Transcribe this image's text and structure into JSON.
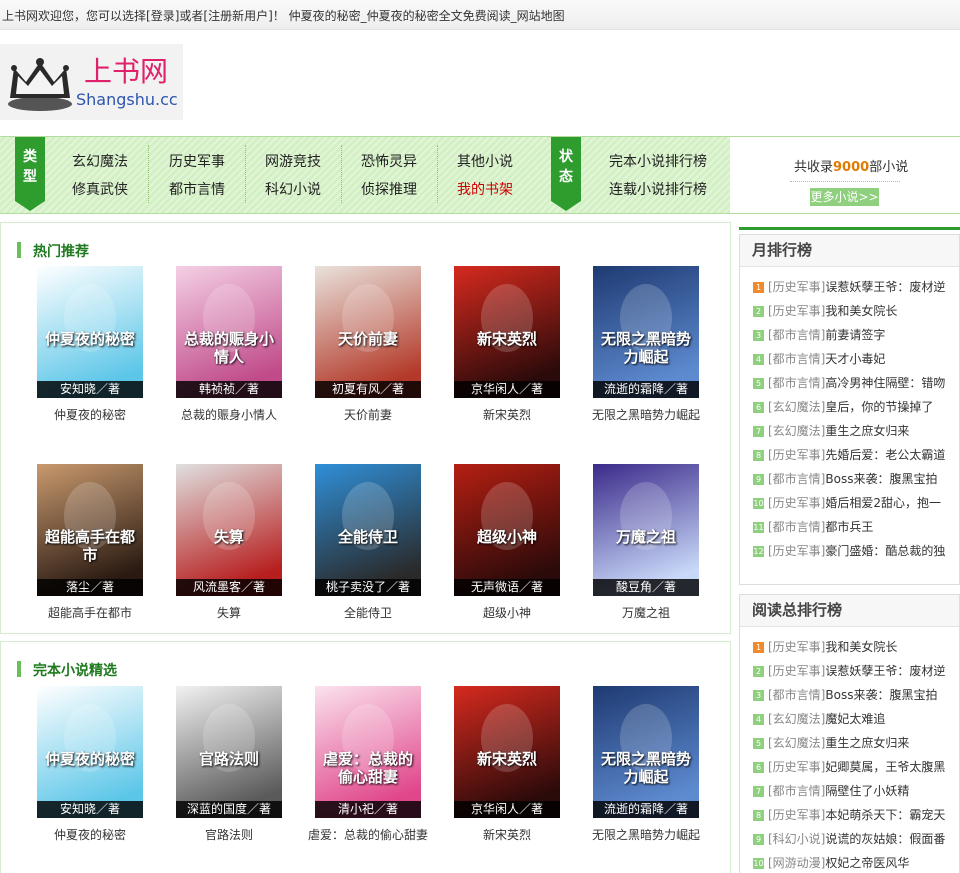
{
  "header": {
    "welcome_prefix": "上书网欢迎您，您可以选择[",
    "login": "登录",
    "or": "]或者[",
    "register": "注册新用户",
    "welcome_suffix": "]！ 仲夏夜的秘密_仲夏夜的秘密全文免费阅读_网站地图"
  },
  "logo": {
    "cn": "上书网",
    "en": "Shangshu.cc"
  },
  "nav": {
    "type_label": [
      "类",
      "型"
    ],
    "status_label": [
      "状",
      "态"
    ],
    "links": [
      "玄幻魔法",
      "修真武侠",
      "历史军事",
      "都市言情",
      "网游竞技",
      "科幻小说",
      "恐怖灵异",
      "侦探推理",
      "其他小说",
      "我的书架"
    ],
    "status_links": [
      "完本小说排行榜",
      "连载小说排行榜"
    ],
    "count_prefix": "共收录",
    "count_num": "9000",
    "count_suffix": "部小说",
    "more": "更多小说>>"
  },
  "hot": {
    "title": "热门推荐",
    "books": [
      {
        "title": "仲夏夜的秘密",
        "author": "安知晓／著",
        "colors": [
          "#ffffff",
          "#5cc6e8"
        ],
        "cover_text": "仲夏夜的秘密"
      },
      {
        "title": "总裁的赈身小情人",
        "author": "韩祯祯／著",
        "colors": [
          "#f4d0e4",
          "#c04a8a"
        ],
        "cover_text": "总裁的赈身小情人"
      },
      {
        "title": "天价前妻",
        "author": "初夏有风／著",
        "colors": [
          "#e9e2dc",
          "#b33a2a"
        ],
        "cover_text": "天价前妻"
      },
      {
        "title": "新宋英烈",
        "author": "京华闲人／著",
        "colors": [
          "#d62a1e",
          "#2a0a0a"
        ],
        "cover_text": "新宋英烈"
      },
      {
        "title": "无限之黑暗势力崛起",
        "author": "流逝的霜降／著",
        "colors": [
          "#1e3a72",
          "#5e8bd0"
        ],
        "cover_text": "无限之黑暗势力崛起"
      },
      {
        "title": "超能高手在都市",
        "author": "落尘／著",
        "colors": [
          "#c99a6e",
          "#2a1a12"
        ],
        "cover_text": "超能高手在都市"
      },
      {
        "title": "失算",
        "author": "风流墨客／著",
        "colors": [
          "#e0e0e0",
          "#b71e1e"
        ],
        "cover_text": "失算"
      },
      {
        "title": "全能侍卫",
        "author": "桃子卖没了／著",
        "colors": [
          "#2f8fd8",
          "#2a2a2a"
        ],
        "cover_text": "全能侍卫"
      },
      {
        "title": "超级小神",
        "author": "无声微语／著",
        "colors": [
          "#b51f12",
          "#2a0a0a"
        ],
        "cover_text": "超级小神"
      },
      {
        "title": "万魔之祖",
        "author": "酸豆角／著",
        "colors": [
          "#3a2a8a",
          "#c8d8f8"
        ],
        "cover_text": "万魔之祖"
      }
    ]
  },
  "finished": {
    "title": "完本小说精选",
    "books": [
      {
        "title": "仲夏夜的秘密",
        "author": "安知晓／著",
        "colors": [
          "#ffffff",
          "#5cc6e8"
        ],
        "cover_text": "仲夏夜的秘密"
      },
      {
        "title": "官路法则",
        "author": "深蓝的国度／著",
        "colors": [
          "#f2f2f2",
          "#5a5a5a"
        ],
        "cover_text": "官路法则"
      },
      {
        "title": "虐爱：总裁的偷心甜妻",
        "author": "清小祀／著",
        "colors": [
          "#fbe2ee",
          "#e0468a"
        ],
        "cover_text": "虐爱：总裁的偷心甜妻"
      },
      {
        "title": "新宋英烈",
        "author": "京华闲人／著",
        "colors": [
          "#d62a1e",
          "#2a0a0a"
        ],
        "cover_text": "新宋英烈"
      },
      {
        "title": "无限之黑暗势力崛起",
        "author": "流逝的霜降／著",
        "colors": [
          "#1e3a72",
          "#5e8bd0"
        ],
        "cover_text": "无限之黑暗势力崛起"
      }
    ]
  },
  "monthly": {
    "title": "月排行榜",
    "items": [
      {
        "num": "1",
        "cat": "[历史军事]",
        "name": "误惹妖孽王爷：废材逆"
      },
      {
        "num": "2",
        "cat": "[历史军事]",
        "name": "我和美女院长"
      },
      {
        "num": "3",
        "cat": "[都市言情]",
        "name": "前妻请签字"
      },
      {
        "num": "4",
        "cat": "[都市言情]",
        "name": "天才小毒妃"
      },
      {
        "num": "5",
        "cat": "[都市言情]",
        "name": "高冷男神住隔壁：错吻"
      },
      {
        "num": "6",
        "cat": "[玄幻魔法]",
        "name": "皇后，你的节操掉了"
      },
      {
        "num": "7",
        "cat": "[玄幻魔法]",
        "name": "重生之庶女归来"
      },
      {
        "num": "8",
        "cat": "[历史军事]",
        "name": "先婚后爱：老公太霸道"
      },
      {
        "num": "9",
        "cat": "[都市言情]",
        "name": "Boss来袭：腹黑宝拍"
      },
      {
        "num": "10",
        "cat": "[历史军事]",
        "name": "婚后相爱2甜心，抱一"
      },
      {
        "num": "11",
        "cat": "[都市言情]",
        "name": "都市兵王"
      },
      {
        "num": "12",
        "cat": "[历史军事]",
        "name": "豪门盛婚：酷总裁的独"
      }
    ]
  },
  "total": {
    "title": "阅读总排行榜",
    "items": [
      {
        "num": "1",
        "cat": "[历史军事]",
        "name": "我和美女院长"
      },
      {
        "num": "2",
        "cat": "[历史军事]",
        "name": "误惹妖孽王爷：废材逆"
      },
      {
        "num": "3",
        "cat": "[都市言情]",
        "name": "Boss来袭：腹黑宝拍"
      },
      {
        "num": "4",
        "cat": "[玄幻魔法]",
        "name": "魔妃太难追"
      },
      {
        "num": "5",
        "cat": "[玄幻魔法]",
        "name": "重生之庶女归来"
      },
      {
        "num": "6",
        "cat": "[历史军事]",
        "name": "妃卿莫属，王爷太腹黑"
      },
      {
        "num": "7",
        "cat": "[都市言情]",
        "name": "隔壁住了小妖精"
      },
      {
        "num": "8",
        "cat": "[历史军事]",
        "name": "本妃萌杀天下：霸宠天"
      },
      {
        "num": "9",
        "cat": "[科幻小说]",
        "name": "说谎的灰姑娘：假面番"
      },
      {
        "num": "10",
        "cat": "[网游动漫]",
        "name": "权妃之帝医风华"
      }
    ]
  }
}
